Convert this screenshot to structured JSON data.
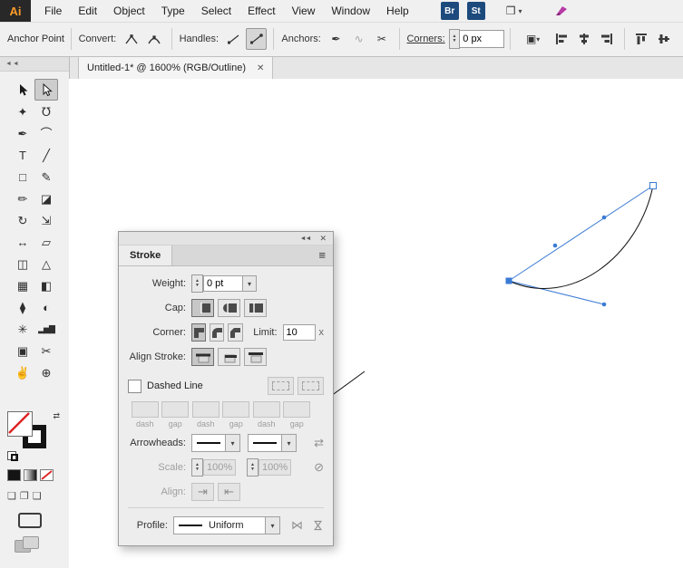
{
  "menubar": {
    "logo": "Ai",
    "items": [
      "File",
      "Edit",
      "Object",
      "Type",
      "Select",
      "Effect",
      "View",
      "Window",
      "Help"
    ],
    "bridge": "Br",
    "stock": "St"
  },
  "controlbar": {
    "title": "Anchor Point",
    "convert_label": "Convert:",
    "handles_label": "Handles:",
    "anchors_label": "Anchors:",
    "corners_label": "Corners:",
    "corners_value": "0 px"
  },
  "tabbar": {
    "title": "Untitled-1* @ 1600% (RGB/Outline)",
    "close": "✕"
  },
  "icons": {
    "workspace": "❒",
    "caret_down": "▾",
    "spin_up": "▲",
    "spin_down": "▼",
    "collapse": "◄◄",
    "close": "✕",
    "panel_menu": "≡",
    "pen_minus": "✒",
    "connect_path": "∿",
    "cut_path": "✂",
    "shape_menu": "▣",
    "swap": "⇄",
    "no_scale": "⊘",
    "align_first": "⇥",
    "align_last": "⇤",
    "flip_along": "⋈"
  },
  "tools": {
    "magic_wand": "✦",
    "lasso": "℧",
    "pen": "✒",
    "curvature": "⌒",
    "type": "T",
    "line": "╱",
    "rectangle": "□",
    "paintbrush": "✎",
    "pencil": "✏",
    "eraser": "◪",
    "rotate": "↻",
    "scale": "⇲",
    "width": "↔",
    "free_transform": "▱",
    "shape_builder": "◫",
    "perspective_grid": "△",
    "mesh": "▦",
    "gradient": "◧",
    "eyedropper": "⧫",
    "blend": "◐",
    "symbol_sprayer": "✳",
    "column_graph": "▂▅▇",
    "artboard": "▣",
    "slice": "✂",
    "hand": "✌",
    "zoom": "⊕",
    "draw_normal": "❏",
    "draw_behind": "❐",
    "draw_inside": "❑"
  },
  "stroke_panel": {
    "tab": "Stroke",
    "weight_label": "Weight:",
    "weight_value": "0 pt",
    "cap_label": "Cap:",
    "corner_label": "Corner:",
    "limit_label": "Limit:",
    "limit_value": "10",
    "limit_suffix": "x",
    "align_stroke_label": "Align Stroke:",
    "dashed_label": "Dashed Line",
    "dash_gap": [
      "dash",
      "gap",
      "dash",
      "gap",
      "dash",
      "gap"
    ],
    "arrowheads_label": "Arrowheads:",
    "scale_label": "Scale:",
    "scale_value1": "100%",
    "scale_value2": "100%",
    "align_label": "Align:",
    "profile_label": "Profile:",
    "profile_value": "Uniform"
  },
  "colors": {
    "selection_blue": "#3b7bd4",
    "logo_orange": "#ff9c2a",
    "adobe_navy": "#1d4a7d"
  }
}
